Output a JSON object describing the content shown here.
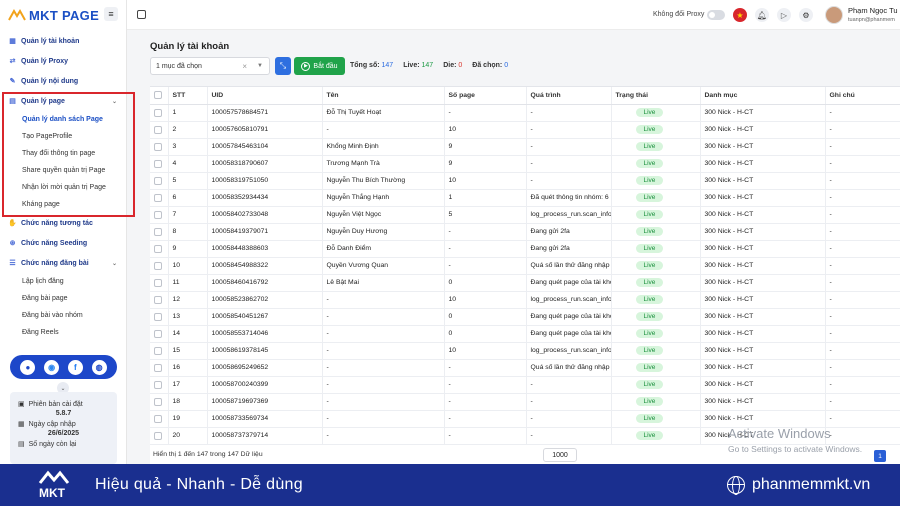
{
  "app": {
    "logo_text": "MKT PAGE"
  },
  "sidebar": {
    "items": [
      {
        "label": "Quản lý tài khoản",
        "icon": "grid-icon"
      },
      {
        "label": "Quản lý Proxy",
        "icon": "proxy-icon"
      },
      {
        "label": "Quản lý nội dung",
        "icon": "content-icon"
      },
      {
        "label": "Quản lý page",
        "icon": "page-icon"
      },
      {
        "label": "Chức năng tương tác",
        "icon": "interact-icon"
      },
      {
        "label": "Chức năng Seeding",
        "icon": "seeding-icon"
      },
      {
        "label": "Chức năng đăng bài",
        "icon": "post-icon"
      }
    ],
    "page_sub": [
      "Quản lý danh sách Page",
      "Tạo PageProfile",
      "Thay đổi thông tin page",
      "Share quyền quản trị Page",
      "Nhận lời mời quản trị Page",
      "Kháng page"
    ],
    "post_sub": [
      "Lập lịch đăng",
      "Đăng bài page",
      "Đăng bài vào nhóm",
      "Đăng Reels"
    ],
    "info": {
      "version_label": "Phiên bản cài đặt",
      "version": "5.8.7",
      "update_label": "Ngày cập nhập",
      "update_date": "26/6/2025",
      "days_label": "Số ngày còn lại"
    }
  },
  "topbar": {
    "proxy_label": "Không đổi Proxy",
    "user_name": "Phạm Ngọc Tu",
    "user_email": "tuanpn@phanmem"
  },
  "main": {
    "title": "Quản lý tài khoản",
    "select_value": "1 mục đã chọn",
    "start_label": "Bắt đầu",
    "stats": {
      "total_label": "Tổng số:",
      "total": "147",
      "live_label": "Live:",
      "live": "147",
      "die_label": "Die:",
      "die": "0",
      "selected_label": "Đã chọn:",
      "selected": "0"
    },
    "columns": [
      "STT",
      "UID",
      "Tên",
      "Số page",
      "Quá trình",
      "Trạng thái",
      "Danh mục",
      "Ghi chú"
    ],
    "rows": [
      [
        "1",
        "100057578684571",
        "Đỗ Thị Tuyết Hoạt",
        "-",
        "-",
        "Live",
        "300 Nick - H-CT",
        "-"
      ],
      [
        "2",
        "100057605810791",
        "-",
        "10",
        "-",
        "Live",
        "300 Nick - H-CT",
        "-"
      ],
      [
        "3",
        "100057845463104",
        "Khổng Minh Định",
        "9",
        "-",
        "Live",
        "300 Nick - H-CT",
        "-"
      ],
      [
        "4",
        "100058318790607",
        "Trương Mạnh Trà",
        "9",
        "-",
        "Live",
        "300 Nick - H-CT",
        "-"
      ],
      [
        "5",
        "100058319751050",
        "Nguyễn Thu Bích Thường",
        "10",
        "-",
        "Live",
        "300 Nick - H-CT",
        "-"
      ],
      [
        "6",
        "100058352934434",
        "Nguyễn Thắng Hạnh",
        "1",
        "Đã quét thông tin nhóm: 6",
        "Live",
        "300 Nick - H-CT",
        "-"
      ],
      [
        "7",
        "100058402733048",
        "Nguyễn Việt Ngọc",
        "5",
        "log_process_run.scan_info",
        "Live",
        "300 Nick - H-CT",
        "-"
      ],
      [
        "8",
        "100058419379071",
        "Nguyễn Duy Hương",
        "-",
        "Đang gửi 2fa",
        "Live",
        "300 Nick - H-CT",
        "-"
      ],
      [
        "9",
        "100058448388603",
        "Đỗ Danh Điểm",
        "-",
        "Đang gửi 2fa",
        "Live",
        "300 Nick - H-CT",
        "-"
      ],
      [
        "10",
        "100058454988322",
        "Quyền Vương Quan",
        "-",
        "Quá số lần thử đăng nhập",
        "Live",
        "300 Nick - H-CT",
        "-"
      ],
      [
        "11",
        "100058460416792",
        "Lê Bật Mai",
        "0",
        "Đang quét page của tài khoản",
        "Live",
        "300 Nick - H-CT",
        "-"
      ],
      [
        "12",
        "100058523862702",
        "-",
        "10",
        "log_process_run.scan_info",
        "Live",
        "300 Nick - H-CT",
        "-"
      ],
      [
        "13",
        "100058540451267",
        "-",
        "0",
        "Đang quét page của tài khoản",
        "Live",
        "300 Nick - H-CT",
        "-"
      ],
      [
        "14",
        "100058553714046",
        "-",
        "0",
        "Đang quét page của tài khoản",
        "Live",
        "300 Nick - H-CT",
        "-"
      ],
      [
        "15",
        "100058619378145",
        "-",
        "10",
        "log_process_run.scan_info",
        "Live",
        "300 Nick - H-CT",
        "-"
      ],
      [
        "16",
        "100058695249652",
        "-",
        "-",
        "Quá số lần thử đăng nhập",
        "Live",
        "300 Nick - H-CT",
        "-"
      ],
      [
        "17",
        "100058700240399",
        "-",
        "-",
        "-",
        "Live",
        "300 Nick - H-CT",
        "-"
      ],
      [
        "18",
        "100058719697369",
        "-",
        "-",
        "-",
        "Live",
        "300 Nick - H-CT",
        "-"
      ],
      [
        "19",
        "100058733569734",
        "-",
        "-",
        "-",
        "Live",
        "300 Nick - H-CT",
        "-"
      ],
      [
        "20",
        "100058737379714",
        "-",
        "-",
        "-",
        "Live",
        "300 Nick - H-CT",
        "-"
      ]
    ],
    "footer_text": "Hiển thị 1 đến 147 trong 147 Dữ liệu",
    "page_size": "1000",
    "page_number": "1"
  },
  "watermark": {
    "title": "Activate Windows",
    "subtitle": "Go to Settings to activate Windows."
  },
  "banner": {
    "logo_text": "MKT",
    "slogan": "Hiệu quả - Nhanh - Dễ dùng",
    "website": "phanmemmkt.vn"
  },
  "colors": {
    "brand": "#1b4fc4",
    "banner": "#1a2f8f",
    "live_bg": "#d7f5dc",
    "start": "#20a34a",
    "highlight": "#d9262c"
  }
}
